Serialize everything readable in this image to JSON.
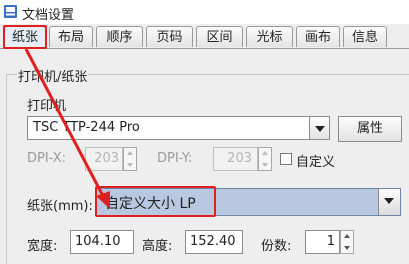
{
  "window": {
    "title": "文档设置"
  },
  "tabs": [
    {
      "label": "纸张",
      "active": true
    },
    {
      "label": "布局"
    },
    {
      "label": "顺序"
    },
    {
      "label": "页码"
    },
    {
      "label": "区间"
    },
    {
      "label": "光标"
    },
    {
      "label": "画布"
    },
    {
      "label": "信息"
    }
  ],
  "group": {
    "title": "打印机/纸张"
  },
  "printer": {
    "label": "打印机",
    "value": "TSC TTP-244 Pro",
    "properties_button": "属性"
  },
  "dpi": {
    "x_label": "DPI-X:",
    "x_value": "203",
    "y_label": "DPI-Y:",
    "y_value": "203",
    "custom_label": "自定义",
    "custom_checked": false
  },
  "paper": {
    "label": "纸张(mm):",
    "value": "自定义大小 LP"
  },
  "size": {
    "width_label": "宽度:",
    "width_value": "104.10",
    "height_label": "高度:",
    "height_value": "152.40",
    "copies_label": "份数:",
    "copies_value": "1"
  },
  "colors": {
    "highlight": "#e02020",
    "selection": "#b8c8e0"
  }
}
